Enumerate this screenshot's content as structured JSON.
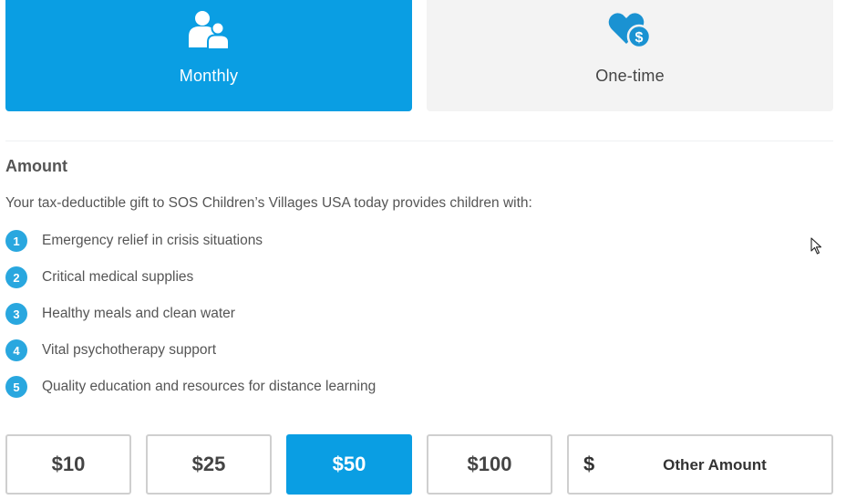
{
  "frequency": {
    "selected": "monthly",
    "options": [
      {
        "id": "monthly",
        "label": "Monthly",
        "icon": "family-icon"
      },
      {
        "id": "onetime",
        "label": "One-time",
        "icon": "heart-dollar-icon"
      }
    ]
  },
  "amount_section": {
    "heading": "Amount",
    "intro": "Your tax-deductible gift to SOS Children’s Villages USA today provides children with:",
    "benefits": [
      {
        "num": "1",
        "text": "Emergency relief in crisis situations"
      },
      {
        "num": "2",
        "text": "Critical medical supplies"
      },
      {
        "num": "3",
        "text": "Healthy meals and clean water"
      },
      {
        "num": "4",
        "text": "Vital psychotherapy support"
      },
      {
        "num": "5",
        "text": "Quality education and resources for distance learning"
      }
    ]
  },
  "amount_options": {
    "selected": "$50",
    "buttons": [
      "$10",
      "$25",
      "$50",
      "$100"
    ],
    "other": {
      "currency": "$",
      "placeholder": "Other Amount",
      "value": ""
    }
  },
  "colors": {
    "accent": "#0a9ee3",
    "badge": "#29a7df",
    "inactive_tab": "#f3f3f3"
  }
}
